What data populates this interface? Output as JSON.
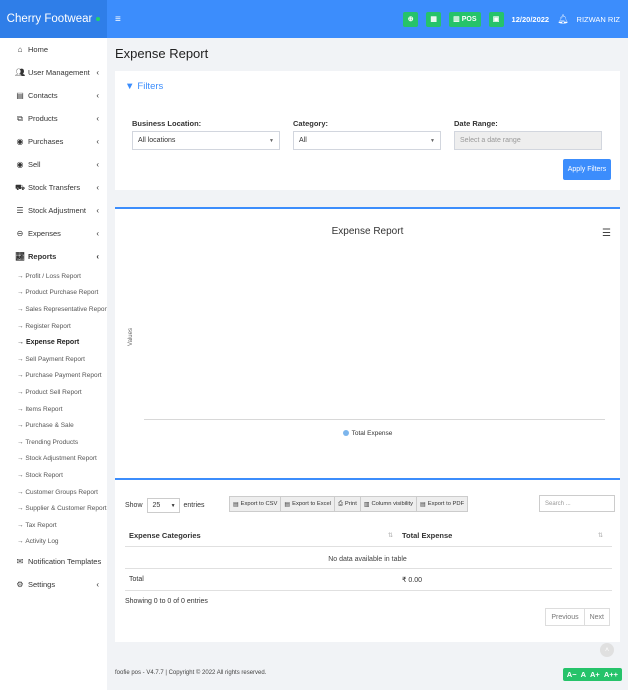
{
  "brand": {
    "name": "Cherry Footwear"
  },
  "topbar": {
    "menu_icon": "hamburger-icon",
    "pos_label": "POS",
    "date": "12/20/2022",
    "user": "RIZWAN RIZ"
  },
  "sidebar": {
    "items": [
      {
        "label": "Home",
        "icon": "home-icon"
      },
      {
        "label": "User Management",
        "icon": "users-icon"
      },
      {
        "label": "Contacts",
        "icon": "address-book-icon"
      },
      {
        "label": "Products",
        "icon": "cubes-icon"
      },
      {
        "label": "Purchases",
        "icon": "arrow-circle-down-icon"
      },
      {
        "label": "Sell",
        "icon": "arrow-circle-up-icon"
      },
      {
        "label": "Stock Transfers",
        "icon": "truck-icon"
      },
      {
        "label": "Stock Adjustment",
        "icon": "database-icon"
      },
      {
        "label": "Expenses",
        "icon": "minus-circle-icon"
      },
      {
        "label": "Reports",
        "icon": "chart-icon"
      }
    ],
    "reports_sub": [
      "Profit / Loss Report",
      "Product Purchase Report",
      "Sales Representative Report",
      "Register Report",
      "Expense Report",
      "Sell Payment Report",
      "Purchase Payment Report",
      "Product Sell Report",
      "Items Report",
      "Purchase & Sale",
      "Trending Products",
      "Stock Adjustment Report",
      "Stock Report",
      "Customer Groups Report",
      "Supplier & Customer Report",
      "Tax Report",
      "Activity Log"
    ],
    "bottom": [
      {
        "label": "Notification Templates",
        "icon": "envelope-icon"
      },
      {
        "label": "Settings",
        "icon": "cog-icon"
      }
    ]
  },
  "page": {
    "title": "Expense Report"
  },
  "filters": {
    "heading": "Filters",
    "location_label": "Business Location:",
    "location_value": "All locations",
    "category_label": "Category:",
    "category_value": "All",
    "date_label": "Date Range:",
    "date_placeholder": "Select a date range",
    "apply_label": "Apply Filters"
  },
  "chart_data": {
    "type": "line",
    "title": "Expense Report",
    "ylabel": "Values",
    "xlabel": "",
    "series": [
      {
        "name": "Total Expense",
        "values": []
      }
    ],
    "legend": "bottom-center",
    "color": "#7cb5ec"
  },
  "table": {
    "show_label": "Show",
    "entries_label": "entries",
    "page_length": "25",
    "exports": [
      "Export to CSV",
      "Export to Excel",
      "Print",
      "Column visibility",
      "Export to PDF"
    ],
    "search_placeholder": "Search ...",
    "columns": [
      "Expense Categories",
      "Total Expense"
    ],
    "empty_message": "No data available in table",
    "total_label": "Total",
    "total_value": "₹ 0.00",
    "info": "Showing 0 to 0 of 0 entries",
    "prev": "Previous",
    "next": "Next"
  },
  "footer": {
    "text": "foofie pos - V4.7.7 | Copyright © 2022 All rights reserved.",
    "text_sizes": [
      "A−",
      "A",
      "A+",
      "A++"
    ]
  }
}
